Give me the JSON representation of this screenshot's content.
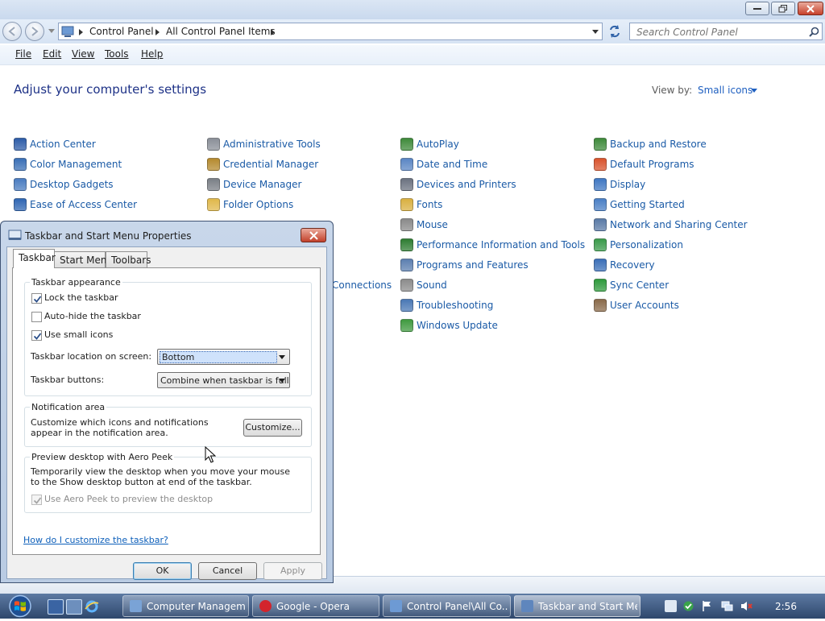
{
  "explorer": {
    "breadcrumb": [
      "Control Panel",
      "All Control Panel Items"
    ],
    "search_placeholder": "Search Control Panel",
    "menu": [
      "File",
      "Edit",
      "View",
      "Tools",
      "Help"
    ],
    "heading": "Adjust your computer's settings",
    "view_by_label": "View by:",
    "view_by_value": "Small icons",
    "columns": [
      [
        {
          "label": "Action Center",
          "icon": "flag-icon",
          "color": "#2d5ca8"
        },
        {
          "label": "Color Management",
          "icon": "monitor-color-icon",
          "color": "#3a6fb6"
        },
        {
          "label": "Desktop Gadgets",
          "icon": "gadgets-icon",
          "color": "#4a7cc0"
        },
        {
          "label": "Ease of Access Center",
          "icon": "accessibility-icon",
          "color": "#2f66b3"
        }
      ],
      [
        {
          "label": "Administrative Tools",
          "icon": "admin-tools-icon",
          "color": "#8a8f98"
        },
        {
          "label": "Credential Manager",
          "icon": "vault-icon",
          "color": "#b58a2e"
        },
        {
          "label": "Device Manager",
          "icon": "device-manager-icon",
          "color": "#7a7f86"
        },
        {
          "label": "Folder Options",
          "icon": "folder-icon",
          "color": "#e0b84a"
        }
      ],
      [
        {
          "label": "AutoPlay",
          "icon": "autoplay-icon",
          "color": "#3e8a3a"
        },
        {
          "label": "Date and Time",
          "icon": "clock-icon",
          "color": "#5a86c4"
        },
        {
          "label": "Devices and Printers",
          "icon": "printer-icon",
          "color": "#6b7280"
        },
        {
          "label": "Fonts",
          "icon": "fonts-icon",
          "color": "#d9b040"
        },
        {
          "label": "Mouse",
          "icon": "mouse-icon",
          "color": "#8a8a8a"
        },
        {
          "label": "Performance Information and Tools",
          "icon": "performance-icon",
          "color": "#2e7d32"
        },
        {
          "label": "Programs and Features",
          "icon": "programs-icon",
          "color": "#5c7fb0"
        },
        {
          "label": "Sound",
          "icon": "speaker-icon",
          "color": "#8c8c8c"
        },
        {
          "label": "Troubleshooting",
          "icon": "troubleshoot-icon",
          "color": "#4a78b5"
        },
        {
          "label": "Windows Update",
          "icon": "windows-update-icon",
          "color": "#3f9a3f"
        }
      ],
      [
        {
          "label": "Backup and Restore",
          "icon": "backup-icon",
          "color": "#3e8a3a"
        },
        {
          "label": "Default Programs",
          "icon": "default-programs-icon",
          "color": "#d9532c"
        },
        {
          "label": "Display",
          "icon": "display-icon",
          "color": "#3f77c2"
        },
        {
          "label": "Getting Started",
          "icon": "getting-started-icon",
          "color": "#4a7fc5"
        },
        {
          "label": "Network and Sharing Center",
          "icon": "network-icon",
          "color": "#5a7aa6"
        },
        {
          "label": "Personalization",
          "icon": "personalization-icon",
          "color": "#3a9a4a"
        },
        {
          "label": "Recovery",
          "icon": "recovery-icon",
          "color": "#3b6fb8"
        },
        {
          "label": "Sync Center",
          "icon": "sync-icon",
          "color": "#2e9a3c"
        },
        {
          "label": "User Accounts",
          "icon": "users-icon",
          "color": "#8a6a4a"
        }
      ]
    ],
    "partial_item": "Connections"
  },
  "dialog": {
    "title": "Taskbar and Start Menu Properties",
    "tabs": [
      "Taskbar",
      "Start Menu",
      "Toolbars"
    ],
    "appearance": {
      "title": "Taskbar appearance",
      "lock_taskbar": {
        "label": "Lock the taskbar",
        "checked": true
      },
      "auto_hide": {
        "label": "Auto-hide the taskbar",
        "checked": false
      },
      "small_icons": {
        "label": "Use small icons",
        "checked": true
      },
      "location_label": "Taskbar location on screen:",
      "location_value": "Bottom",
      "buttons_label": "Taskbar buttons:",
      "buttons_value": "Combine when taskbar is full"
    },
    "notification": {
      "title": "Notification area",
      "description": "Customize which icons and notifications appear in the notification area.",
      "button": "Customize..."
    },
    "aero_peek": {
      "title": "Preview desktop with Aero Peek",
      "description": "Temporarily view the desktop when you move your mouse to the Show desktop button at end of the taskbar.",
      "checkbox": {
        "label": "Use Aero Peek to preview the desktop",
        "checked": true,
        "disabled": true
      }
    },
    "help_link": "How do I customize the taskbar?",
    "buttons": {
      "ok": "OK",
      "cancel": "Cancel",
      "apply": "Apply"
    }
  },
  "taskbar": {
    "items": [
      {
        "label": "Computer Managem...",
        "icon": "computer-management-icon",
        "color": "#7aa3d6"
      },
      {
        "label": "Google - Opera",
        "icon": "opera-icon",
        "color": "#d3242c"
      },
      {
        "label": "Control Panel\\All Co...",
        "icon": "control-panel-icon",
        "color": "#6d9ad4"
      },
      {
        "label": "Taskbar and Start Me...",
        "icon": "taskbar-properties-icon",
        "color": "#5f86bd"
      }
    ],
    "clock": "2:56"
  }
}
